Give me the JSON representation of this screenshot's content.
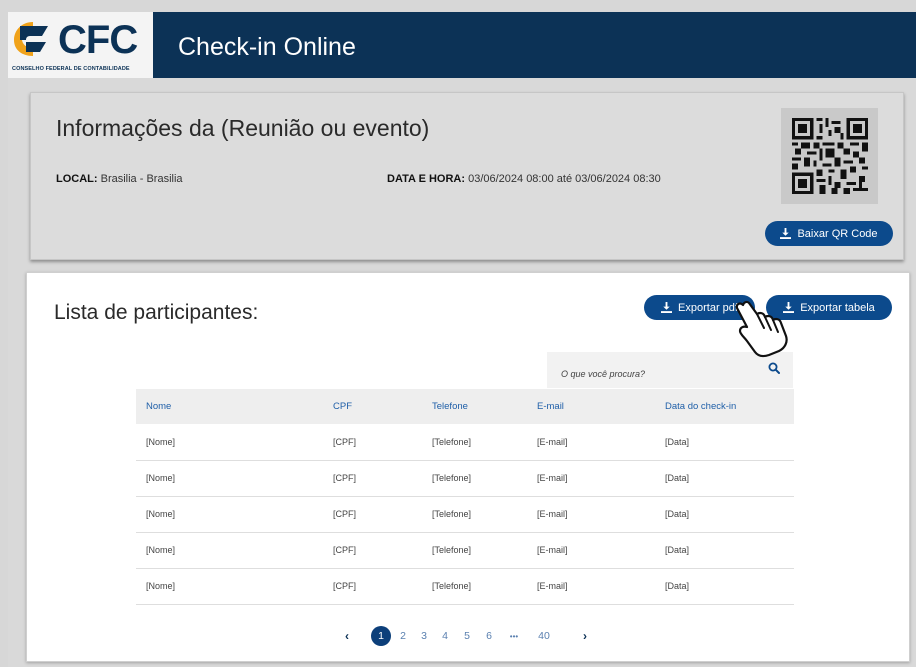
{
  "header": {
    "logo_text": "CFC",
    "logo_subtitle": "CONSELHO FEDERAL DE CONTABILIDADE",
    "app_title": "Check-in Online",
    "brand_color": "#0c3256"
  },
  "info": {
    "title": "Informações da (Reunião ou evento)",
    "local_label": "LOCAL:",
    "local_value": "Brasilia - Brasilia",
    "datetime_label": "DATA E HORA:",
    "datetime_value": "03/06/2024 08:00 até 03/06/2024 08:30",
    "qr_icon": "qr-code-icon",
    "download_qr_label": "Baixar QR Code"
  },
  "list": {
    "title": "Lista de participantes:",
    "export_pdf_label": "Exportar pdf",
    "export_table_label": "Exportar tabela",
    "search_placeholder": "O que você procura?",
    "columns": {
      "nome": "Nome",
      "cpf": "CPF",
      "telefone": "Telefone",
      "email": "E-mail",
      "checkin": "Data do check-in"
    },
    "rows": [
      {
        "nome": "[Nome]",
        "cpf": "[CPF]",
        "telefone": "[Telefone]",
        "email": "[E-mail]",
        "data": "[Data]"
      },
      {
        "nome": "[Nome]",
        "cpf": "[CPF]",
        "telefone": "[Telefone]",
        "email": "[E-mail]",
        "data": "[Data]"
      },
      {
        "nome": "[Nome]",
        "cpf": "[CPF]",
        "telefone": "[Telefone]",
        "email": "[E-mail]",
        "data": "[Data]"
      },
      {
        "nome": "[Nome]",
        "cpf": "[CPF]",
        "telefone": "[Telefone]",
        "email": "[E-mail]",
        "data": "[Data]"
      },
      {
        "nome": "[Nome]",
        "cpf": "[CPF]",
        "telefone": "[Telefone]",
        "email": "[E-mail]",
        "data": "[Data]"
      }
    ]
  },
  "pagination": {
    "prev": "‹",
    "pages": [
      "1",
      "2",
      "3",
      "4",
      "5",
      "6"
    ],
    "ellipsis": "•••",
    "last": "40",
    "next": "›",
    "current": "1"
  }
}
